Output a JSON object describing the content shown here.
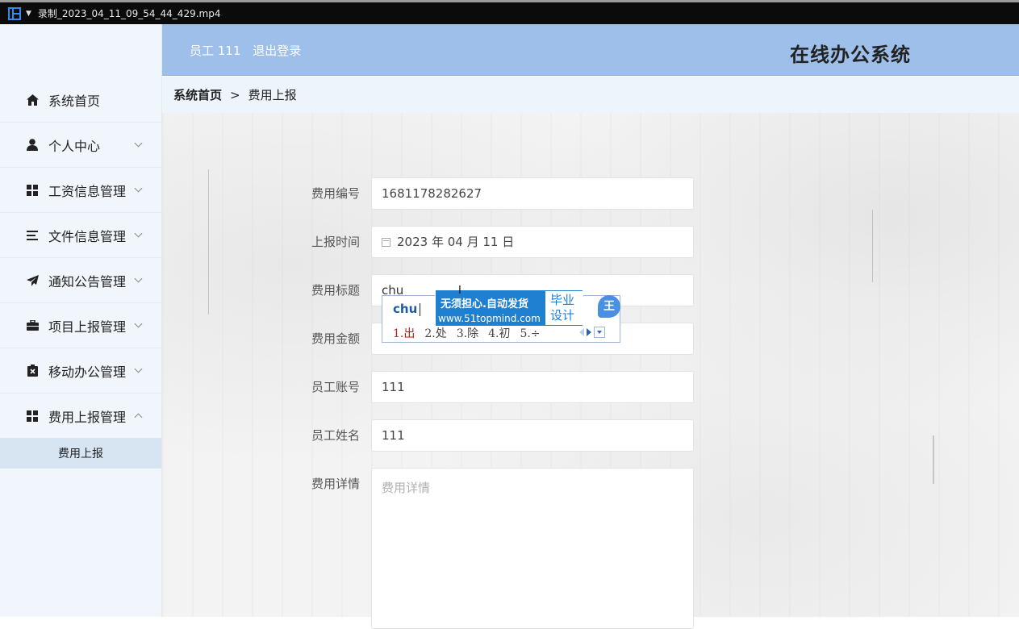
{
  "window": {
    "title": "录制_2023_04_11_09_54_44_429.mp4"
  },
  "header": {
    "user_label": "员工 111",
    "logout_label": "退出登录",
    "system_title": "在线办公系统"
  },
  "sidebar": {
    "items": [
      {
        "label": "系统首页",
        "icon": "home-icon"
      },
      {
        "label": "个人中心",
        "icon": "user-icon"
      },
      {
        "label": "工资信息管理",
        "icon": "grid-icon"
      },
      {
        "label": "文件信息管理",
        "icon": "list-icon"
      },
      {
        "label": "通知公告管理",
        "icon": "send-icon"
      },
      {
        "label": "项目上报管理",
        "icon": "briefcase-icon"
      },
      {
        "label": "移动办公管理",
        "icon": "clipboard-icon"
      },
      {
        "label": "费用上报管理",
        "icon": "grid-icon"
      }
    ],
    "sub_item": "费用上报"
  },
  "breadcrumb": {
    "home": "系统首页",
    "separator": ">",
    "current": "费用上报"
  },
  "form": {
    "fee_no": {
      "label": "费用编号",
      "value": "1681178282627"
    },
    "report_time": {
      "label": "上报时间",
      "value": "2023 年 04 月 11 日"
    },
    "fee_title": {
      "label": "费用标题",
      "value": "chu"
    },
    "fee_amount": {
      "label": "费用金额",
      "value": ""
    },
    "staff_account": {
      "label": "员工账号",
      "value": "111"
    },
    "staff_name": {
      "label": "员工姓名",
      "value": "111"
    },
    "fee_detail": {
      "label": "费用详情",
      "placeholder": "费用详情"
    }
  },
  "ime": {
    "composition": "chu",
    "candidates": [
      "1.出",
      "2.处",
      "3.除",
      "4.初",
      "5.÷"
    ],
    "ad_line1": "无须担心.自动发货",
    "ad_line2": "www.51topmind.com",
    "ad_box": "毕业设计",
    "logo": "王"
  },
  "colors": {
    "header_bg": "#9dbfe9",
    "sidebar_bg": "#f1f6fc",
    "accent": "#1f7fd1"
  }
}
